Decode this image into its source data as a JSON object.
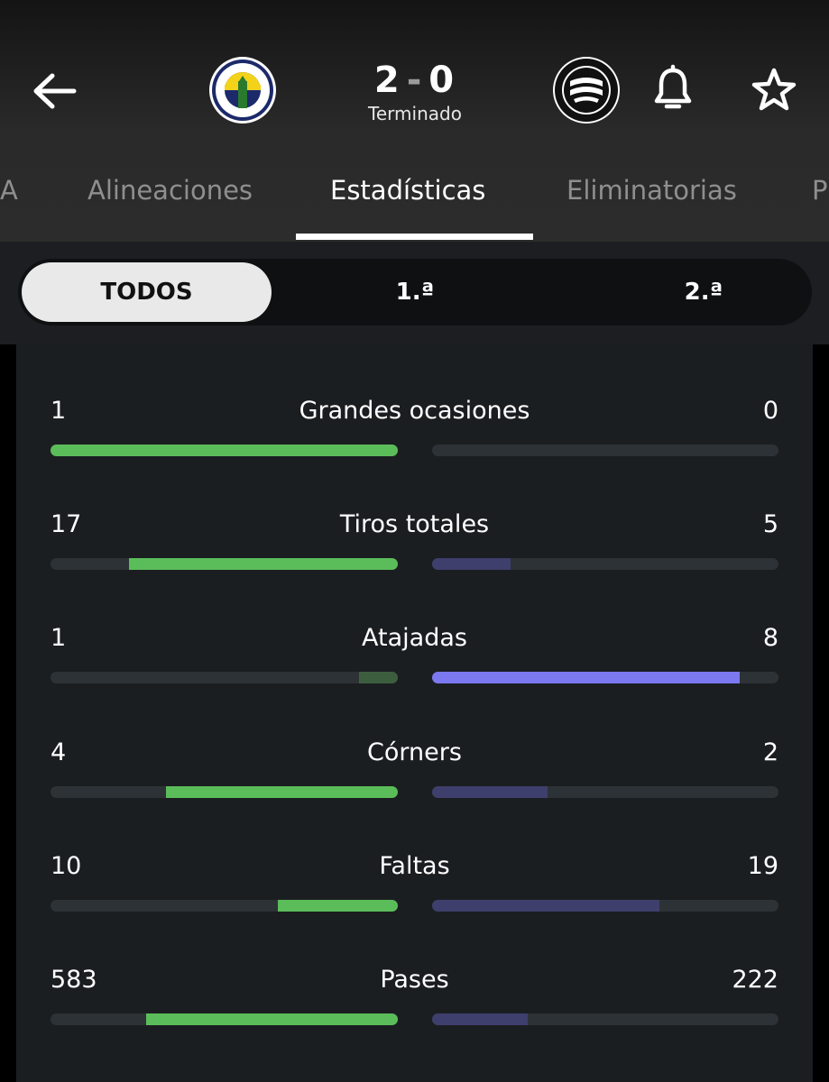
{
  "match": {
    "home_score": "2",
    "separator": "-",
    "away_score": "0",
    "status": "Terminado",
    "home_team_crest": "fenerbahce-crest",
    "away_team_crest": "sturm-graz-crest"
  },
  "tabs": [
    {
      "label": "A"
    },
    {
      "label": "Alineaciones"
    },
    {
      "label": "Estadísticas",
      "active": true
    },
    {
      "label": "Eliminatorias"
    },
    {
      "label": "P"
    }
  ],
  "periods": [
    {
      "label": "TODOS",
      "active": true
    },
    {
      "label": "1.ª"
    },
    {
      "label": "2.ª"
    }
  ],
  "colors": {
    "home_strong": "#5bbd5a",
    "home_weak": "#3d5e3e",
    "away_strong": "#7b78f0",
    "away_weak": "#3e3f6c",
    "track": "#2d3236"
  },
  "stats": [
    {
      "label": "Grandes ocasiones",
      "home": "1",
      "away": "0",
      "home_ratio": 1.0,
      "away_ratio": 0.0,
      "home_leads": true
    },
    {
      "label": "Tiros totales",
      "home": "17",
      "away": "5",
      "home_ratio": 0.773,
      "away_ratio": 0.227,
      "home_leads": true
    },
    {
      "label": "Atajadas",
      "home": "1",
      "away": "8",
      "home_ratio": 0.111,
      "away_ratio": 0.889,
      "home_leads": false
    },
    {
      "label": "Córners",
      "home": "4",
      "away": "2",
      "home_ratio": 0.667,
      "away_ratio": 0.333,
      "home_leads": true
    },
    {
      "label": "Faltas",
      "home": "10",
      "away": "19",
      "home_ratio": 0.345,
      "away_ratio": 0.655,
      "home_leads": true
    },
    {
      "label": "Pases",
      "home": "583",
      "away": "222",
      "home_ratio": 0.724,
      "away_ratio": 0.276,
      "home_leads": true
    }
  ]
}
